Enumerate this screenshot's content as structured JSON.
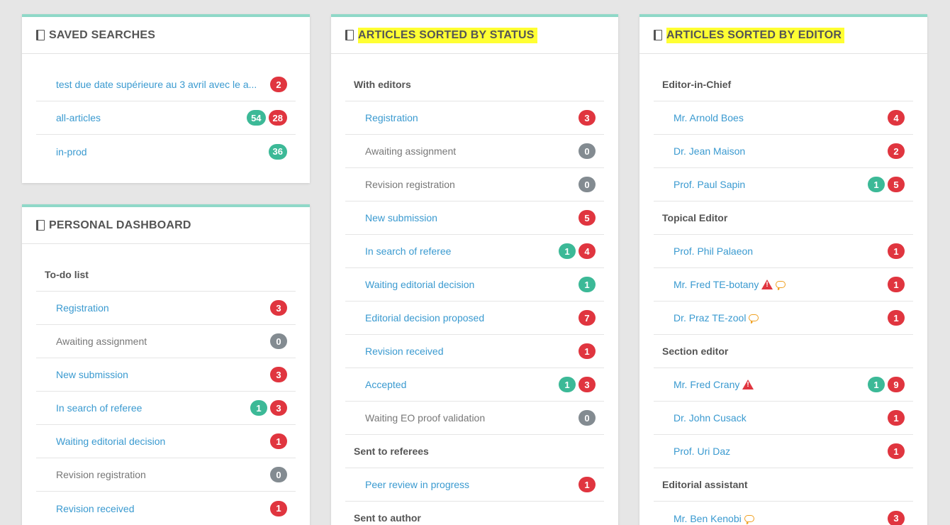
{
  "saved": {
    "title": "SAVED SEARCHES",
    "rows": [
      {
        "label": "test due date supérieure au 3 avril avec le a...",
        "link": true,
        "badges": [
          {
            "v": "2",
            "c": "red"
          }
        ]
      },
      {
        "label": "all-articles",
        "link": true,
        "badges": [
          {
            "v": "54",
            "c": "green"
          },
          {
            "v": "28",
            "c": "red"
          }
        ]
      },
      {
        "label": "in-prod",
        "link": true,
        "badges": [
          {
            "v": "36",
            "c": "green"
          }
        ]
      }
    ]
  },
  "personal": {
    "title": "PERSONAL DASHBOARD",
    "items": [
      {
        "type": "group",
        "label": "To-do list"
      },
      {
        "label": "Registration",
        "link": true,
        "badges": [
          {
            "v": "3",
            "c": "red"
          }
        ]
      },
      {
        "label": "Awaiting assignment",
        "link": false,
        "badges": [
          {
            "v": "0",
            "c": "grey"
          }
        ]
      },
      {
        "label": "New submission",
        "link": true,
        "badges": [
          {
            "v": "3",
            "c": "red"
          }
        ]
      },
      {
        "label": "In search of referee",
        "link": true,
        "badges": [
          {
            "v": "1",
            "c": "green"
          },
          {
            "v": "3",
            "c": "red"
          }
        ]
      },
      {
        "label": "Waiting editorial decision",
        "link": true,
        "badges": [
          {
            "v": "1",
            "c": "red"
          }
        ]
      },
      {
        "label": "Revision registration",
        "link": false,
        "badges": [
          {
            "v": "0",
            "c": "grey"
          }
        ]
      },
      {
        "label": "Revision received",
        "link": true,
        "badges": [
          {
            "v": "1",
            "c": "red"
          }
        ]
      }
    ]
  },
  "status": {
    "title": "ARTICLES SORTED BY STATUS",
    "items": [
      {
        "type": "group",
        "label": "With editors"
      },
      {
        "label": "Registration",
        "link": true,
        "badges": [
          {
            "v": "3",
            "c": "red"
          }
        ]
      },
      {
        "label": "Awaiting assignment",
        "link": false,
        "badges": [
          {
            "v": "0",
            "c": "grey"
          }
        ]
      },
      {
        "label": "Revision registration",
        "link": false,
        "badges": [
          {
            "v": "0",
            "c": "grey"
          }
        ]
      },
      {
        "label": "New submission",
        "link": true,
        "badges": [
          {
            "v": "5",
            "c": "red"
          }
        ]
      },
      {
        "label": "In search of referee",
        "link": true,
        "badges": [
          {
            "v": "1",
            "c": "green"
          },
          {
            "v": "4",
            "c": "red"
          }
        ]
      },
      {
        "label": "Waiting editorial decision",
        "link": true,
        "badges": [
          {
            "v": "1",
            "c": "green"
          }
        ]
      },
      {
        "label": "Editorial decision proposed",
        "link": true,
        "badges": [
          {
            "v": "7",
            "c": "red"
          }
        ]
      },
      {
        "label": "Revision received",
        "link": true,
        "badges": [
          {
            "v": "1",
            "c": "red"
          }
        ]
      },
      {
        "label": "Accepted",
        "link": true,
        "badges": [
          {
            "v": "1",
            "c": "green"
          },
          {
            "v": "3",
            "c": "red"
          }
        ]
      },
      {
        "label": "Waiting EO proof validation",
        "link": false,
        "badges": [
          {
            "v": "0",
            "c": "grey"
          }
        ]
      },
      {
        "type": "group",
        "label": "Sent to referees"
      },
      {
        "label": "Peer review in progress",
        "link": true,
        "badges": [
          {
            "v": "1",
            "c": "red"
          }
        ]
      },
      {
        "type": "group",
        "label": "Sent to author"
      }
    ]
  },
  "editor": {
    "title": "ARTICLES SORTED BY EDITOR",
    "items": [
      {
        "type": "group",
        "label": "Editor-in-Chief"
      },
      {
        "label": "Mr. Arnold Boes",
        "link": true,
        "badges": [
          {
            "v": "4",
            "c": "red"
          }
        ]
      },
      {
        "label": "Dr. Jean Maison",
        "link": true,
        "badges": [
          {
            "v": "2",
            "c": "red"
          }
        ]
      },
      {
        "label": "Prof. Paul Sapin",
        "link": true,
        "badges": [
          {
            "v": "1",
            "c": "green"
          },
          {
            "v": "5",
            "c": "red"
          }
        ]
      },
      {
        "type": "group",
        "label": "Topical Editor"
      },
      {
        "label": "Prof. Phil Palaeon",
        "link": true,
        "badges": [
          {
            "v": "1",
            "c": "red"
          }
        ]
      },
      {
        "label": "Mr. Fred TE-botany",
        "link": true,
        "warn": true,
        "chat": true,
        "badges": [
          {
            "v": "1",
            "c": "red"
          }
        ]
      },
      {
        "label": "Dr. Praz TE-zool",
        "link": true,
        "chat": true,
        "badges": [
          {
            "v": "1",
            "c": "red"
          }
        ]
      },
      {
        "type": "group",
        "label": "Section editor"
      },
      {
        "label": "Mr. Fred Crany",
        "link": true,
        "warn": true,
        "badges": [
          {
            "v": "1",
            "c": "green"
          },
          {
            "v": "9",
            "c": "red"
          }
        ]
      },
      {
        "label": "Dr. John Cusack",
        "link": true,
        "badges": [
          {
            "v": "1",
            "c": "red"
          }
        ]
      },
      {
        "label": "Prof. Uri Daz",
        "link": true,
        "badges": [
          {
            "v": "1",
            "c": "red"
          }
        ]
      },
      {
        "type": "group",
        "label": "Editorial assistant"
      },
      {
        "label": "Mr. Ben Kenobi",
        "link": true,
        "chat": true,
        "badges": [
          {
            "v": "3",
            "c": "red"
          }
        ]
      }
    ]
  }
}
